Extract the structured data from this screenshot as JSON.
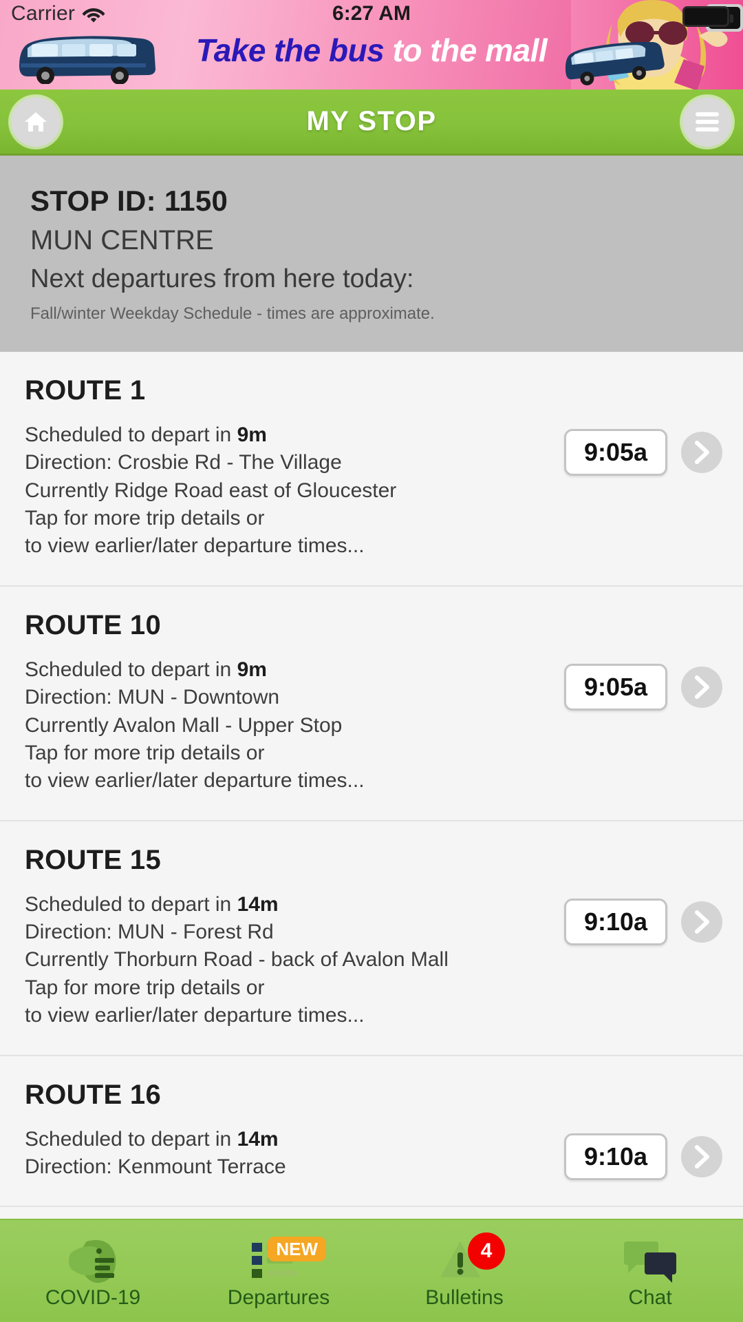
{
  "status_bar": {
    "carrier": "Carrier",
    "time": "6:27 AM",
    "wifi_icon": "wifi-icon",
    "battery_icon": "battery-icon"
  },
  "ad": {
    "text_strong": "Take the bus",
    "text_light": "to the mall",
    "bus_icon": "bus-icon",
    "model_image": "woman-shopping-image"
  },
  "header": {
    "title": "MY STOP",
    "home_icon": "home-icon",
    "menu_icon": "hamburger-menu-icon"
  },
  "stop_info": {
    "stop_id": "STOP ID: 1150",
    "stop_name": "MUN CENTRE",
    "next_departures": "Next departures from here today:",
    "schedule_note": "Fall/winter Weekday Schedule - times are approximate."
  },
  "routes": [
    {
      "title": "ROUTE 1",
      "scheduled_prefix": "Scheduled to depart in ",
      "scheduled_value": "9m",
      "direction": "Direction: Crosbie Rd - The Village",
      "currently": "Currently Ridge Road east of Gloucester",
      "tap_line1": "Tap for more trip details or",
      "tap_line2": "to view earlier/later departure times...",
      "time": "9:05a",
      "chevron_icon": "chevron-right-icon"
    },
    {
      "title": "ROUTE 10",
      "scheduled_prefix": "Scheduled to depart in ",
      "scheduled_value": "9m",
      "direction": "Direction: MUN - Downtown",
      "currently": "Currently Avalon Mall - Upper Stop",
      "tap_line1": "Tap for more trip details or",
      "tap_line2": "to view earlier/later departure times...",
      "time": "9:05a",
      "chevron_icon": "chevron-right-icon"
    },
    {
      "title": "ROUTE 15",
      "scheduled_prefix": "Scheduled to depart in ",
      "scheduled_value": "14m",
      "direction": "Direction: MUN - Forest Rd",
      "currently": "Currently Thorburn Road - back of Avalon Mall",
      "tap_line1": "Tap for more trip details or",
      "tap_line2": "to view earlier/later departure times...",
      "time": "9:10a",
      "chevron_icon": "chevron-right-icon"
    },
    {
      "title": "ROUTE 16",
      "scheduled_prefix": "Scheduled to depart in ",
      "scheduled_value": "14m",
      "direction": "Direction: Kenmount Terrace",
      "currently": "",
      "tap_line1": "",
      "tap_line2": "",
      "time": "9:10a",
      "chevron_icon": "chevron-right-icon"
    }
  ],
  "tab_bar": {
    "tabs": [
      {
        "label": "COVID-19",
        "icon": "face-mask-icon",
        "badge": ""
      },
      {
        "label": "Departures",
        "icon": "list-icon",
        "badge": "NEW"
      },
      {
        "label": "Bulletins",
        "icon": "warning-triangle-icon",
        "badge": "4"
      },
      {
        "label": "Chat",
        "icon": "chat-bubbles-icon",
        "badge": ""
      }
    ]
  },
  "colors": {
    "header_green": "#8dc63f",
    "tabbar_green": "#9acd5f",
    "info_gray": "#bfbfbf",
    "badge_new_orange": "#f5a623",
    "badge_count_red": "#f30000",
    "ad_pink": "#f78fb9",
    "ad_blue_text": "#2a19b8"
  }
}
